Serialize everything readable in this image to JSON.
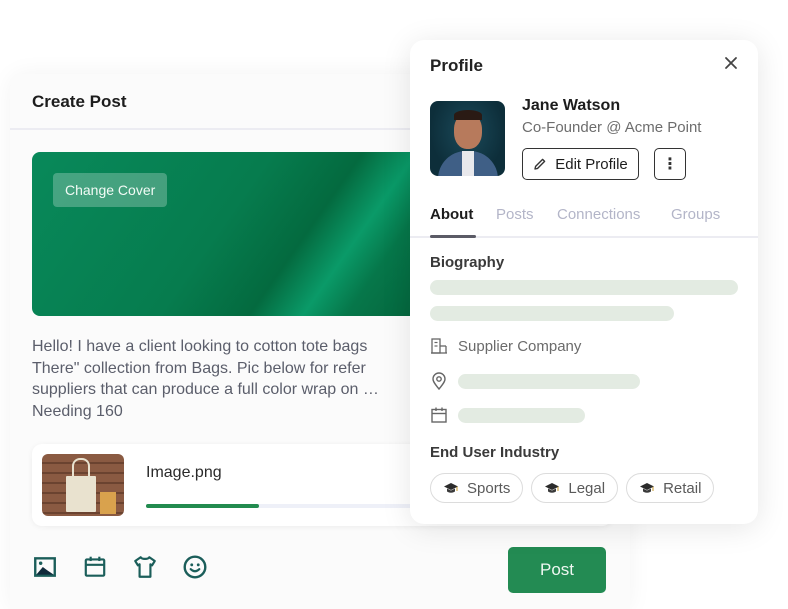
{
  "create_post": {
    "title": "Create Post",
    "change_cover_label": "Change Cover",
    "post_text": "Hello! I have a client looking to cotton tote bags\nThere\" collection from Bags. Pic below for refer\nsuppliers that can produce a full color wrap on …\nNeeding 160",
    "attachment": {
      "file_name": "Image.png",
      "upload_progress_percent": 25
    },
    "toolbar": {
      "icons": [
        "image-icon",
        "calendar-icon",
        "shirt-icon",
        "smiley-icon"
      ]
    },
    "post_button_label": "Post",
    "accent_color": "#238b53"
  },
  "profile": {
    "title": "Profile",
    "close_icon": "close-icon",
    "name": "Jane Watson",
    "role": "Co-Founder @ Acme Point",
    "edit_profile_label": "Edit Profile",
    "more_label": "⋮",
    "tabs": [
      {
        "label": "About",
        "active": true
      },
      {
        "label": "Posts",
        "active": false
      },
      {
        "label": "Connections",
        "active": false
      },
      {
        "label": "Groups",
        "active": false
      }
    ],
    "biography_label": "Biography",
    "company": "Supplier Company",
    "end_user_industry_label": "End User Industry",
    "industries": [
      "Sports",
      "Legal",
      "Retail"
    ]
  }
}
